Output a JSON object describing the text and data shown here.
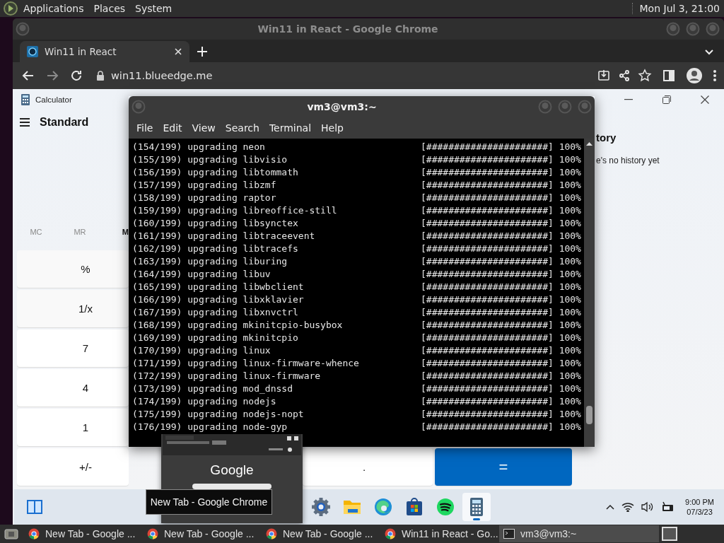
{
  "top_panel": {
    "menus": [
      "Applications",
      "Places",
      "System"
    ],
    "clock": "Mon Jul 3, 21:00"
  },
  "chrome": {
    "title": "Win11 in React - Google Chrome",
    "tabs": [
      {
        "label": "Win11 in React",
        "selected": true
      }
    ],
    "url": "win11.blueedge.me"
  },
  "calculator": {
    "title": "Calculator",
    "mode": "Standard",
    "memory": [
      {
        "label": "MC",
        "disabled": true
      },
      {
        "label": "MR",
        "disabled": true
      },
      {
        "label": "M",
        "disabled": false
      }
    ],
    "left_keys": [
      {
        "label": "%",
        "kind": "function"
      },
      {
        "label": "1/x",
        "kind": "function"
      },
      {
        "label": "7",
        "kind": "digit"
      },
      {
        "label": "4",
        "kind": "digit"
      },
      {
        "label": "1",
        "kind": "digit"
      }
    ],
    "bottom_keys": [
      {
        "label": "+/-",
        "kind": "digit"
      },
      {
        "label": ".",
        "kind": "digit"
      },
      {
        "label": "=",
        "kind": "equals"
      }
    ],
    "history_title": "tory",
    "history_empty": "e's no history yet"
  },
  "win11_taskbar": {
    "apps": [
      {
        "kind": "settings",
        "selected": false
      },
      {
        "kind": "files",
        "selected": false
      },
      {
        "kind": "edge",
        "selected": false
      },
      {
        "kind": "store",
        "selected": false
      },
      {
        "kind": "spotify",
        "selected": false
      },
      {
        "kind": "calculator",
        "selected": true
      }
    ],
    "time": "9:00 PM",
    "date": "07/3/23"
  },
  "terminal": {
    "title": "vm3@vm3:~",
    "menu": [
      "File",
      "Edit",
      "View",
      "Search",
      "Terminal",
      "Help"
    ],
    "lines": [
      {
        "text": "(154/199) upgrading neon",
        "bar": "[######################]",
        "percent": "100%"
      },
      {
        "text": "(155/199) upgrading libvisio",
        "bar": "[######################]",
        "percent": "100%"
      },
      {
        "text": "(156/199) upgrading libtommath",
        "bar": "[######################]",
        "percent": "100%"
      },
      {
        "text": "(157/199) upgrading libzmf",
        "bar": "[######################]",
        "percent": "100%"
      },
      {
        "text": "(158/199) upgrading raptor",
        "bar": "[######################]",
        "percent": "100%"
      },
      {
        "text": "(159/199) upgrading libreoffice-still",
        "bar": "[######################]",
        "percent": "100%"
      },
      {
        "text": "(160/199) upgrading libsynctex",
        "bar": "[######################]",
        "percent": "100%"
      },
      {
        "text": "(161/199) upgrading libtraceevent",
        "bar": "[######################]",
        "percent": "100%"
      },
      {
        "text": "(162/199) upgrading libtracefs",
        "bar": "[######################]",
        "percent": "100%"
      },
      {
        "text": "(163/199) upgrading liburing",
        "bar": "[######################]",
        "percent": "100%"
      },
      {
        "text": "(164/199) upgrading libuv",
        "bar": "[######################]",
        "percent": "100%"
      },
      {
        "text": "(165/199) upgrading libwbclient",
        "bar": "[######################]",
        "percent": "100%"
      },
      {
        "text": "(166/199) upgrading libxklavier",
        "bar": "[######################]",
        "percent": "100%"
      },
      {
        "text": "(167/199) upgrading libxnvctrl",
        "bar": "[######################]",
        "percent": "100%"
      },
      {
        "text": "(168/199) upgrading mkinitcpio-busybox",
        "bar": "[######################]",
        "percent": "100%"
      },
      {
        "text": "(169/199) upgrading mkinitcpio",
        "bar": "[######################]",
        "percent": "100%"
      },
      {
        "text": "(170/199) upgrading linux",
        "bar": "[######################]",
        "percent": "100%"
      },
      {
        "text": "(171/199) upgrading linux-firmware-whence",
        "bar": "[######################]",
        "percent": "100%"
      },
      {
        "text": "(172/199) upgrading linux-firmware",
        "bar": "[######################]",
        "percent": "100%"
      },
      {
        "text": "(173/199) upgrading mod_dnssd",
        "bar": "[######################]",
        "percent": "100%"
      },
      {
        "text": "(174/199) upgrading nodejs",
        "bar": "[######################]",
        "percent": "100%"
      },
      {
        "text": "(175/199) upgrading nodejs-nopt",
        "bar": "[######################]",
        "percent": "100%"
      },
      {
        "text": "(176/199) upgrading node-gyp",
        "bar": "[######################]",
        "percent": "100%"
      }
    ]
  },
  "tab_preview": {
    "logo": "Google",
    "tooltip": "New Tab - Google Chrome"
  },
  "bottom_panel": {
    "tasks": [
      {
        "label": "New Tab - Google ...",
        "kind": "browser",
        "selected": false
      },
      {
        "label": "New Tab - Google ...",
        "kind": "browser",
        "selected": false
      },
      {
        "label": "New Tab - Google ...",
        "kind": "browser",
        "selected": false
      },
      {
        "label": "Win11 in React - Go...",
        "kind": "browser",
        "selected": false
      },
      {
        "label": "vm3@vm3:~",
        "kind": "terminal",
        "selected": true
      }
    ]
  }
}
